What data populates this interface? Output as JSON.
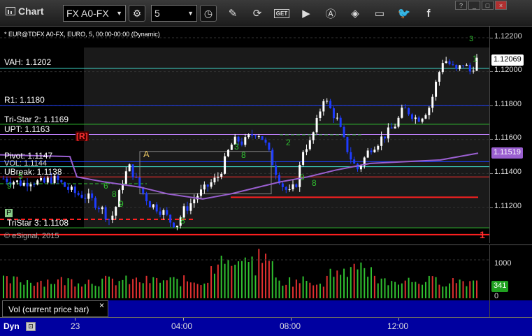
{
  "toolbar": {
    "title": "Chart",
    "symbol": "FX A0-FX",
    "interval": "5",
    "icons": [
      "settings-icon",
      "clock-icon",
      "pencil-icon",
      "refresh-icon",
      "get-icon",
      "play-icon",
      "alert-icon",
      "tag-icon",
      "chat-icon",
      "twitter-icon",
      "facebook-icon"
    ],
    "get_label": "GET",
    "window_buttons": [
      "?",
      "_",
      "□",
      "×"
    ]
  },
  "chart": {
    "header": "* EUR@TDFX A0-FX, EURO, 5, 00:00-00:00 (Dynamic)",
    "copyright": "© eSignal, 2015",
    "levels": [
      {
        "label": "VAH: 1.1202",
        "color": "#40e0d0"
      },
      {
        "label": "R1: 1.1180",
        "color": "#2040ff"
      },
      {
        "label": "Tri-Star 2: 1.1169",
        "color": "#30c030"
      },
      {
        "label": "UPT: 1.1163",
        "color": "#c080ff"
      },
      {
        "label": "Pivot: 1.1147",
        "color": "#2040ff"
      },
      {
        "label": "VOL: 1.1144",
        "color": "#40e0d0"
      },
      {
        "label": "UBreak: 1.1138",
        "color": "#ff3030"
      },
      {
        "label": "TriStar 3: 1.1108",
        "color": "#30c030"
      }
    ],
    "markers": {
      "r_box": "[R]",
      "a_label": "A",
      "p_box": "P",
      "right_1": "1",
      "top_3": "3"
    }
  },
  "price_axis": {
    "ticks": [
      "1.12200",
      "1.12000",
      "1.11800",
      "1.11600",
      "1.11400",
      "1.11200"
    ],
    "last_price": "1.12069",
    "ma_value": "1.11519"
  },
  "volume": {
    "legend": "Vol (current price bar)",
    "close_glyph": "×",
    "ticks": [
      "1000",
      "0"
    ],
    "current": "341"
  },
  "time_axis": {
    "dyn_label": "Dyn",
    "ticks": [
      "23",
      "04:00",
      "08:00",
      "12:00"
    ]
  },
  "colors": {
    "up": "#ffffff",
    "down": "#1e3cff",
    "vol_up": "#30c030",
    "vol_down": "#e03030",
    "panel_bg": "#000000",
    "axis_bg": "#0000a0"
  }
}
